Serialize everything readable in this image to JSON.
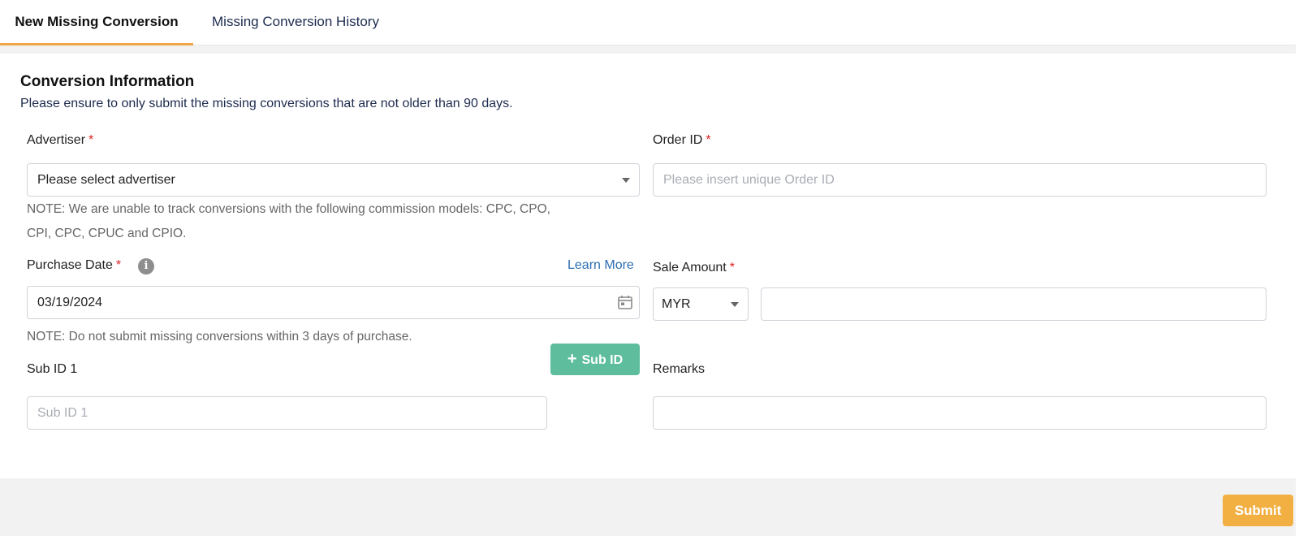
{
  "tabs": {
    "new_label": "New Missing Conversion",
    "history_label": "Missing Conversion History"
  },
  "section": {
    "title": "Conversion Information",
    "subtitle": "Please ensure to only submit the missing conversions that are not older than 90 days."
  },
  "advertiser": {
    "label": "Advertiser",
    "required_mark": "*",
    "selected": "Please select advertiser",
    "note_line1": "NOTE: We are unable to track conversions with the following commission models: CPC, CPO,",
    "note_line2": "CPI, CPC, CPUC and CPIO."
  },
  "order_id": {
    "label": "Order ID",
    "required_mark": "*",
    "placeholder": "Please insert unique Order ID"
  },
  "purchase_date": {
    "label": "Purchase Date",
    "required_mark": "*",
    "info_glyph": "i",
    "learn_more": "Learn More",
    "value": "03/19/2024",
    "note": "NOTE: Do not submit missing conversions within 3 days of purchase."
  },
  "sale_amount": {
    "label": "Sale Amount",
    "required_mark": "*",
    "currency": "MYR",
    "amount": ""
  },
  "sub_id": {
    "label": "Sub ID 1",
    "placeholder": "Sub ID 1",
    "add_button_plus": "+",
    "add_button_label": "Sub ID"
  },
  "remarks": {
    "label": "Remarks",
    "value": ""
  },
  "submit": {
    "label": "Submit"
  },
  "colors": {
    "accent_tab": "#f0a64a",
    "submit_bg": "#f2b043",
    "subid_bg": "#5dbd9c",
    "link": "#2c6fb2",
    "required": "#dd2222"
  },
  "icons": {
    "calendar": "calendar-icon",
    "info": "info-icon",
    "dropdown": "chevron-down-icon",
    "plus": "plus-icon"
  }
}
